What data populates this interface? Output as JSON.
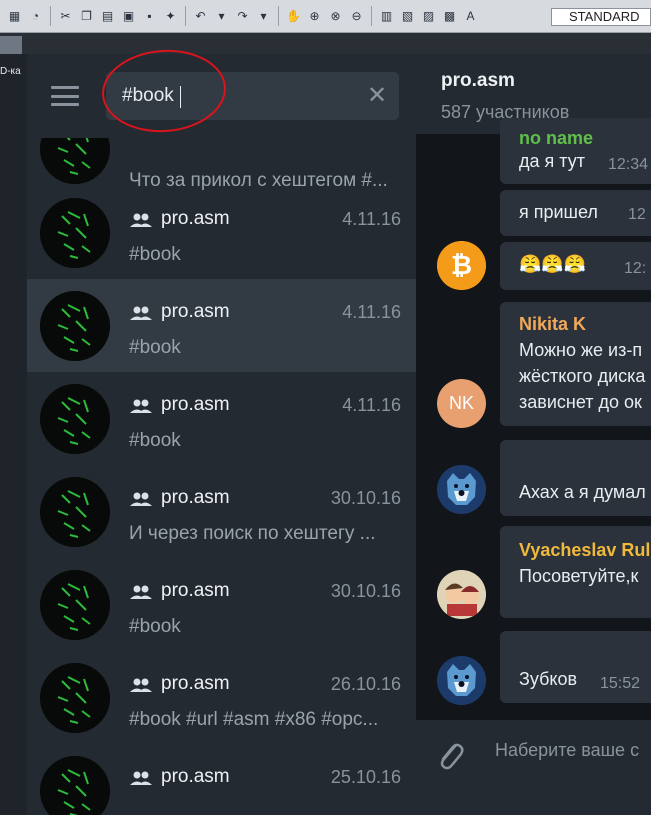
{
  "toolbar": {
    "icons": [
      "grid-icon",
      "globe-icon",
      "cut-icon",
      "copy-icon",
      "paste-icon",
      "print-icon",
      "save-icon",
      "wand-icon",
      "undo-icon",
      "dropdown-icon",
      "redo-icon",
      "dropdown-icon",
      "pan-icon",
      "zoom-icon",
      "zoom-window-icon",
      "zoom-prev-icon",
      "properties-icon",
      "sheet-icon",
      "tool-palette-icon",
      "calculator-icon",
      "text-style-icon"
    ],
    "dropdown_value": "STANDARD"
  },
  "side_label": "D-ка",
  "search": {
    "value": "#book",
    "clear_glyph": "✕"
  },
  "results": [
    {
      "name": "",
      "date": "",
      "message": "Что за прикол с хештегом #..."
    },
    {
      "name": "pro.asm",
      "date": "4.11.16",
      "message": "#book"
    },
    {
      "name": "pro.asm",
      "date": "4.11.16",
      "message": "#book"
    },
    {
      "name": "pro.asm",
      "date": "4.11.16",
      "message": "#book"
    },
    {
      "name": "pro.asm",
      "date": "30.10.16",
      "message": "И через поиск по хештегу ..."
    },
    {
      "name": "pro.asm",
      "date": "30.10.16",
      "message": "#book"
    },
    {
      "name": "pro.asm",
      "date": "26.10.16",
      "message": "#book #url #asm #x86 #opc..."
    },
    {
      "name": "pro.asm",
      "date": "25.10.16",
      "message": ""
    }
  ],
  "chat": {
    "title": "pro.asm",
    "subtitle": "587 участников",
    "messages": [
      {
        "name": "no name",
        "text": "да я тут",
        "time": "12:34"
      },
      {
        "text": "я пришел",
        "time": "12"
      },
      {
        "text": "😤😤😤",
        "time": "12:"
      },
      {
        "name": "Nikita K",
        "lines": [
          "Можно же из-п",
          "жёсткого диска",
          "зависнет до ок"
        ],
        "avatar_text": "NK"
      },
      {
        "text": "Ахах а я думал"
      },
      {
        "name": "Vyacheslav Rul",
        "text": "Посоветуйте,к"
      },
      {
        "text": "Зубков",
        "time": "15:52"
      }
    ],
    "colors": {
      "nikita": "#f0a85a",
      "vyacheslav": "#f0b93a",
      "noname": "#5fbf4a"
    },
    "input_placeholder": "Наберите ваше с"
  }
}
